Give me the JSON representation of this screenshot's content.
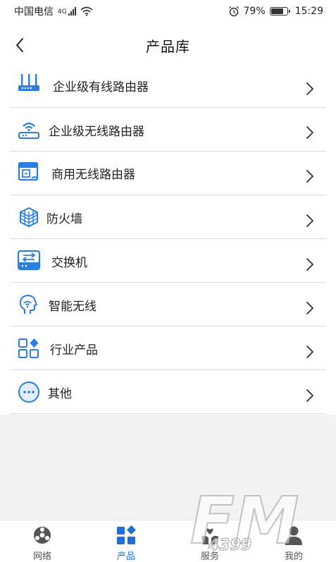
{
  "status_bar": {
    "carrier": "中国电信",
    "network_type": "4G",
    "battery": "79%",
    "time": "15:29"
  },
  "header": {
    "title": "产品库",
    "back_icon": "chevron-left-icon"
  },
  "products": [
    {
      "label": "企业级有线路由器",
      "icon": "wired-router-icon"
    },
    {
      "label": "企业级无线路由器",
      "icon": "wireless-router-icon"
    },
    {
      "label": "商用无线路由器",
      "icon": "commercial-router-icon"
    },
    {
      "label": "防火墙",
      "icon": "firewall-icon"
    },
    {
      "label": "交换机",
      "icon": "switch-icon"
    },
    {
      "label": "智能无线",
      "icon": "smart-wireless-icon"
    },
    {
      "label": "行业产品",
      "icon": "industry-apps-icon"
    },
    {
      "label": "其他",
      "icon": "more-dots-icon"
    }
  ],
  "tabs": [
    {
      "label": "网络",
      "icon": "network-icon",
      "active": false
    },
    {
      "label": "产品",
      "icon": "products-grid-icon",
      "active": true
    },
    {
      "label": "服务",
      "icon": "service-hands-icon",
      "active": false
    },
    {
      "label": "我的",
      "icon": "profile-icon",
      "active": false
    }
  ],
  "colors": {
    "accent": "#1e6fd9",
    "icon_blue": "#2b7de0",
    "background": "#f2f2f2"
  },
  "watermark": {
    "brand": "FM",
    "number": "4399"
  }
}
